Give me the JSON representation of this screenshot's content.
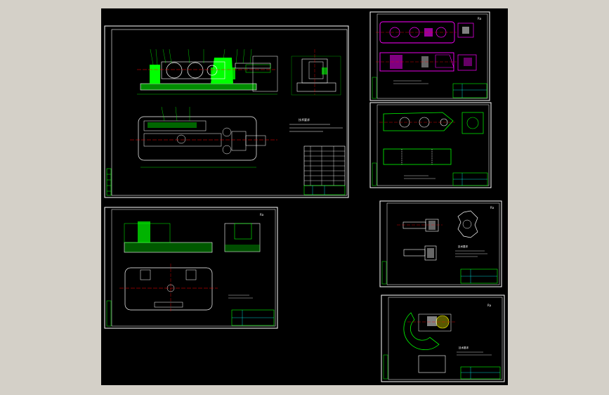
{
  "colors": {
    "background": "#d4d0c8",
    "model_space": "#000000",
    "frame": "#ffffff",
    "green": "#00ff00",
    "magenta": "#ff00ff",
    "red": "#ff0000",
    "cyan": "#00ffff",
    "yellow": "#ffff00"
  },
  "sheets": [
    {
      "id": "assembly-drawing",
      "title": "",
      "tech_notes_heading": "技术要求",
      "tech_notes": [
        "",
        "",
        ""
      ],
      "corner_mark": ""
    },
    {
      "id": "part-sheet-2",
      "title": "",
      "corner_mark": "Ra"
    },
    {
      "id": "part-sheet-3",
      "title": "",
      "corner_mark": ""
    },
    {
      "id": "part-sheet-4",
      "title": "",
      "corner_mark": "Ra"
    },
    {
      "id": "part-sheet-5",
      "title": "",
      "tech_notes_heading": "技术要求",
      "corner_mark": "Ra"
    },
    {
      "id": "part-sheet-6",
      "title": "",
      "tech_notes_heading": "技术要求",
      "corner_mark": "Ra"
    }
  ]
}
